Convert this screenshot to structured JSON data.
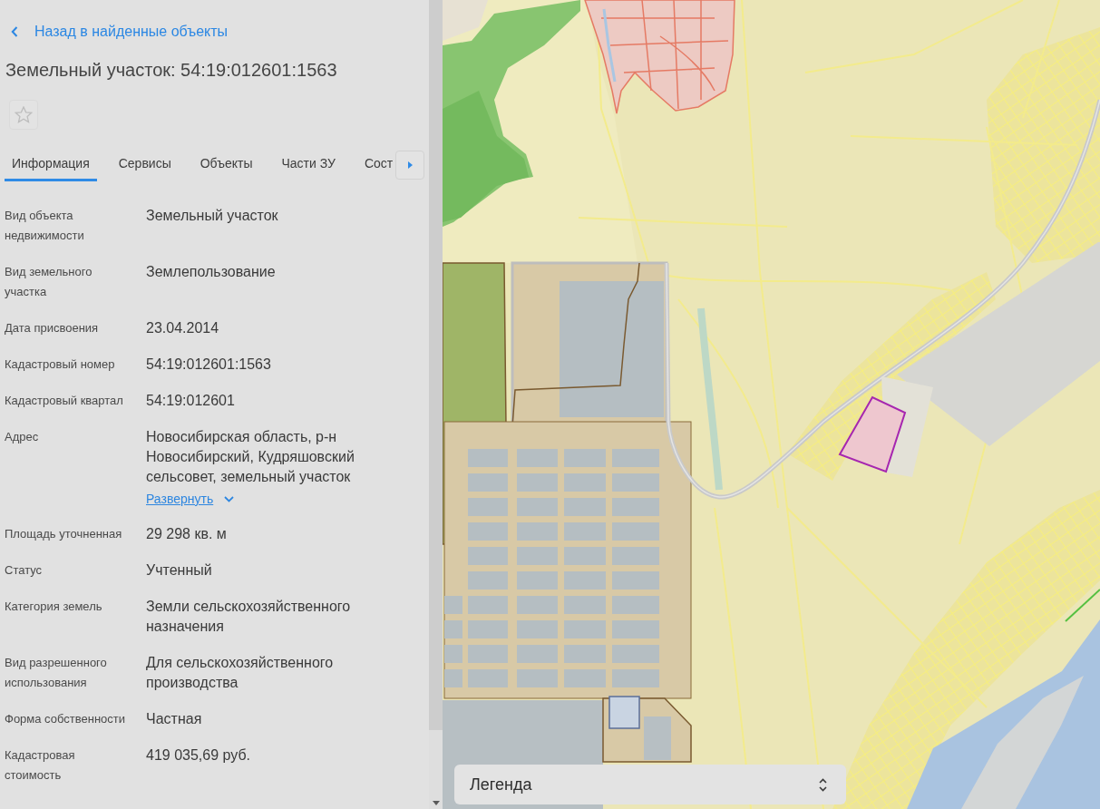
{
  "back_link": {
    "label": "Назад в найденные объекты"
  },
  "title": "Земельный участок: 54:19:012601:1563",
  "favorite": {
    "starred": false
  },
  "tabs": [
    {
      "label": "Информация",
      "selected": true
    },
    {
      "label": "Сервисы",
      "selected": false
    },
    {
      "label": "Объекты",
      "selected": false
    },
    {
      "label": "Части ЗУ",
      "selected": false
    },
    {
      "label": "Сост",
      "selected": false
    }
  ],
  "properties": [
    {
      "label": "Вид объекта недвижимости",
      "value": "Земельный участок"
    },
    {
      "label": "Вид земельного участка",
      "value": "Землепользование"
    },
    {
      "label": "Дата присвоения",
      "value": "23.04.2014"
    },
    {
      "label": "Кадастровый номер",
      "value": "54:19:012601:1563"
    },
    {
      "label": "Кадастровый квартал",
      "value": "54:19:012601"
    },
    {
      "label": "Адрес",
      "value": "Новосибирская область, р-н Новосибирский, Кудряшовский сельсовет, земельный участок",
      "expand_link": "Развернуть"
    },
    {
      "label": "Площадь уточненная",
      "value": "29 298 кв. м"
    },
    {
      "label": "Статус",
      "value": "Учтенный"
    },
    {
      "label": "Категория земель",
      "value": "Земли сельскохозяйственного назначения"
    },
    {
      "label": "Вид разрешенного использования",
      "value": "Для сельскохозяйственного производства"
    },
    {
      "label": "Форма собственности",
      "value": "Частная"
    },
    {
      "label": "Кадастровая стоимость",
      "value": "419 035,69 руб."
    }
  ],
  "map": {
    "legend": {
      "label": "Легенда"
    }
  }
}
